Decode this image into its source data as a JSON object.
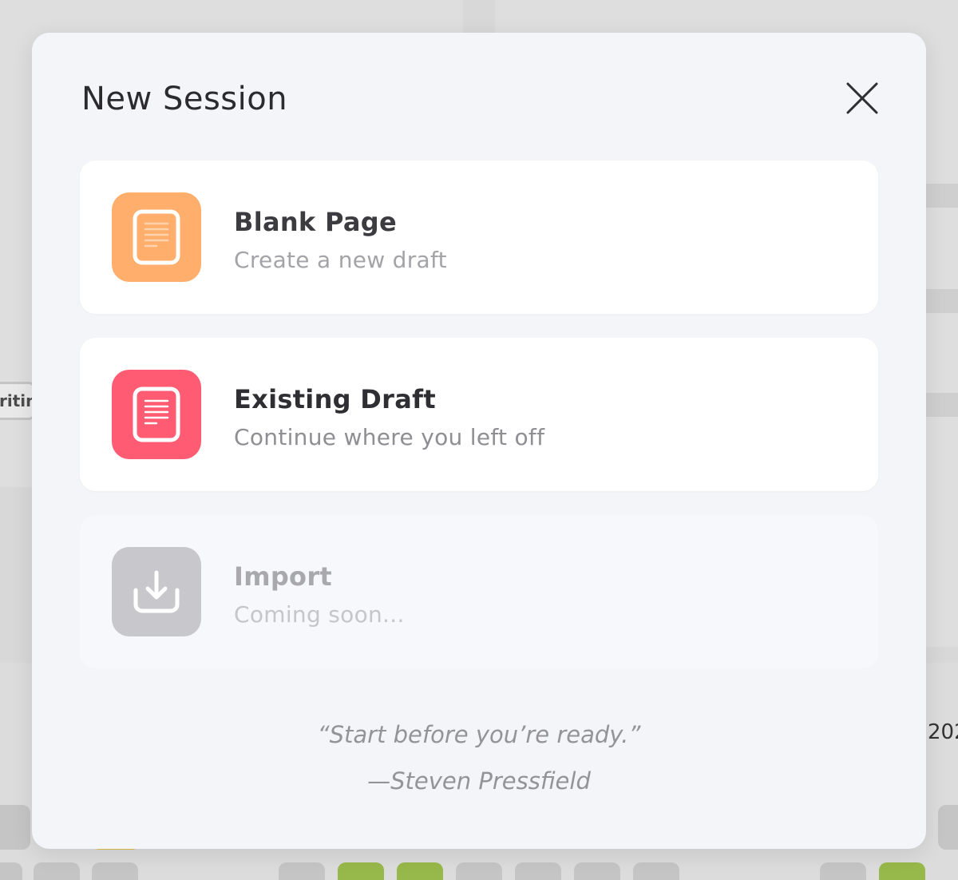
{
  "modal": {
    "title": "New Session",
    "close_label": "Close"
  },
  "options": [
    {
      "title": "Blank Page",
      "subtitle": "Create a new draft",
      "icon": "blank-document-icon",
      "icon_color": "#FFAE6B",
      "enabled": true
    },
    {
      "title": "Existing Draft",
      "subtitle": "Continue where you left off",
      "icon": "draft-document-icon",
      "icon_color": "#FF5B72",
      "enabled": true
    },
    {
      "title": "Import",
      "subtitle": "Coming soon...",
      "icon": "import-download-icon",
      "icon_color": "#C8C8CC",
      "enabled": false
    }
  ],
  "quote": {
    "text": "“Start before you’re ready.”",
    "author": "—Steven Pressfield"
  },
  "background": {
    "tag_text": "riting",
    "year_text": "202"
  }
}
